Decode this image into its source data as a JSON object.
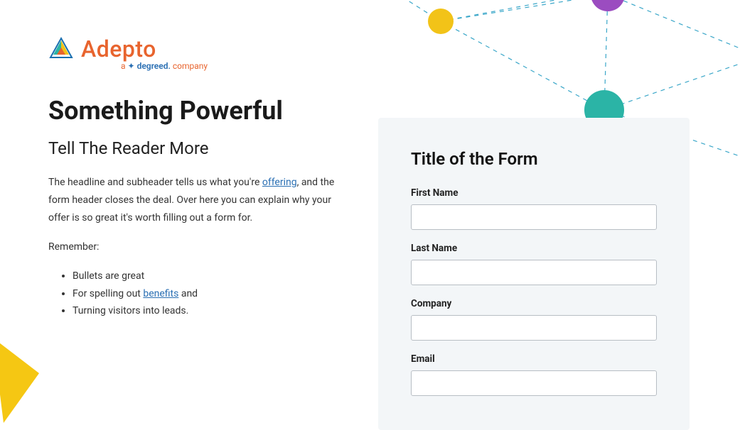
{
  "brand": {
    "name": "Adepto",
    "tagline_prefix": "a",
    "tagline_mid": "degreed.",
    "tagline_suffix": "company"
  },
  "hero": {
    "headline": "Something Powerful",
    "subheadline": "Tell The Reader More",
    "paragraph_pre": "The headline and subheader tells us what you're ",
    "paragraph_link": "offering",
    "paragraph_post": ", and the form header closes the deal. Over here you can explain why your offer is so great it's worth filling out a form for.",
    "remember": "Remember:",
    "bullets": {
      "b1": "Bullets are great",
      "b2_pre": "For spelling out ",
      "b2_link": "benefits",
      "b2_post": " and",
      "b3": "Turning visitors into leads."
    }
  },
  "form": {
    "title": "Title of the Form",
    "first_name_label": "First Name",
    "last_name_label": "Last Name",
    "company_label": "Company",
    "email_label": "Email"
  }
}
